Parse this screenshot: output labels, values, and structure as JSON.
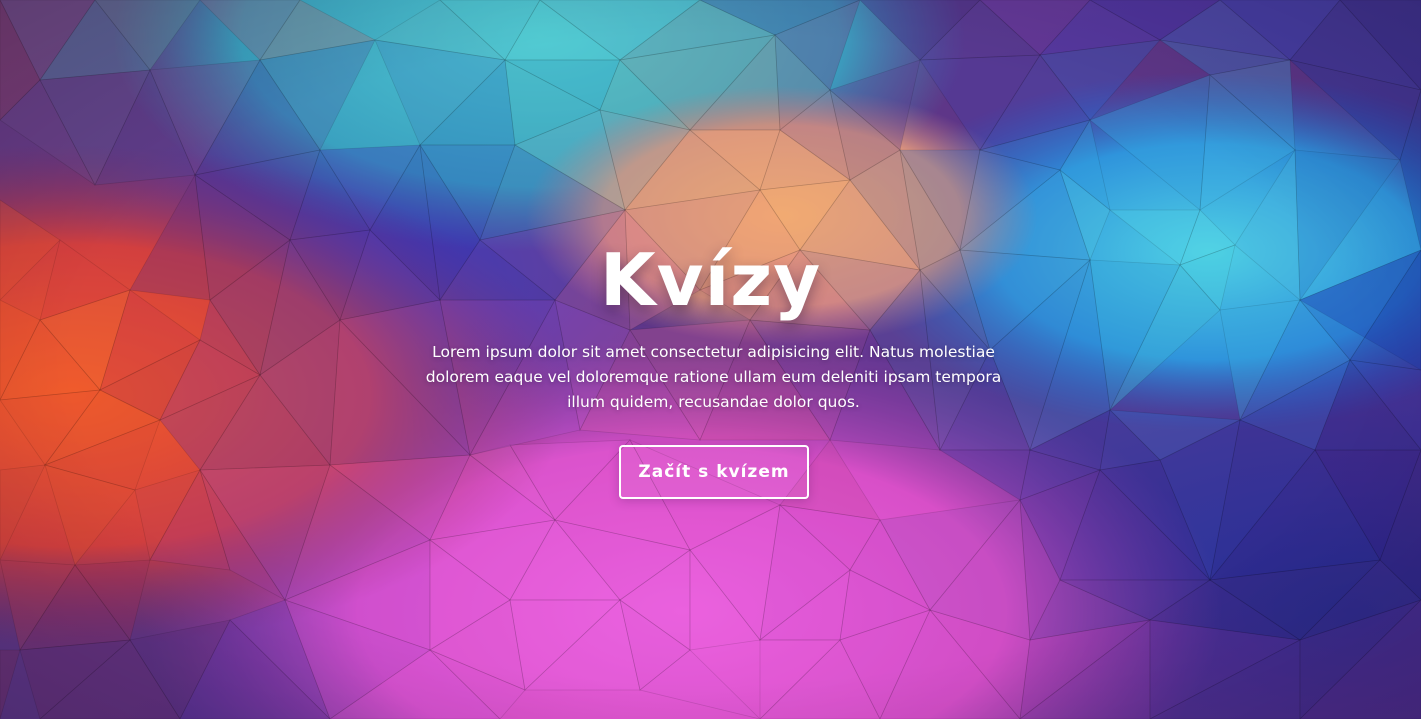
{
  "hero": {
    "title": "Kvízy",
    "description": "Lorem ipsum dolor sit amet consectetur adipisicing elit. Natus molestiae dolorem eaque vel doloremque ratione ullam eum deleniti ipsam tempora illum quidem, recusandae dolor quos.",
    "cta_label": "Začít s kvízem"
  },
  "background": {
    "style": "low-poly triangles",
    "palette": [
      "#e8552e",
      "#c2306b",
      "#5a2ca8",
      "#3a37b8",
      "#4fc3d0",
      "#f0a877",
      "#e85ed8",
      "#2a6fd6",
      "#1d2f9a"
    ]
  },
  "colors": {
    "text": "#ffffff",
    "button_border": "#ffffff"
  }
}
